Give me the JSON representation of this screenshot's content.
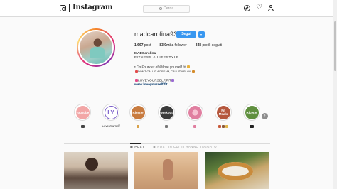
{
  "app": {
    "logo_text": "Instagram"
  },
  "search": {
    "placeholder": "Cerca"
  },
  "profile": {
    "username": "madcarolina93",
    "follow_label": "Segui",
    "more_label": "···",
    "stats": {
      "posts_value": "1.667",
      "posts_label": "post",
      "followers_value": "83,9mila",
      "followers_label": "follower",
      "following_value": "348",
      "following_label": "profili seguiti"
    },
    "bio": {
      "name": "MADCarolina",
      "tagline": "FITNESS & LIFESTYLE",
      "line1": "• Co Founder of @love.yourself.fit",
      "line2": "DON'T CALL IT A DREAM, CALL IT A PLAN",
      "line3": "LOVEYOURSELF.FIT",
      "link": "www.loveyourself.fit"
    }
  },
  "highlights": [
    {
      "title": "YouTube",
      "label": "",
      "color": "#f2a6a6"
    },
    {
      "title": "LY",
      "label": "LoveYourself",
      "color": "#7b5fc9"
    },
    {
      "title": "Ricette",
      "label": "",
      "color": "#c87b3f"
    },
    {
      "title": "workout",
      "label": "",
      "color": "#3a3a3a"
    },
    {
      "title": "",
      "label": "",
      "color": "#e07fa0"
    },
    {
      "title": "Fit Meals",
      "label": "",
      "color": "#b5573d"
    },
    {
      "title": "Ricette",
      "label": "",
      "color": "#5f8f3e"
    }
  ],
  "tabs": {
    "posts": "POST",
    "tagged": "POST IN CUI TI HANNO TAGGATO"
  },
  "colors": {
    "accent": "#3897f0",
    "link": "#003569"
  },
  "icons": [
    "instagram-icon",
    "search-icon",
    "compass-icon",
    "heart-icon",
    "user-icon",
    "chevron-down-icon",
    "chevron-right-icon"
  ]
}
